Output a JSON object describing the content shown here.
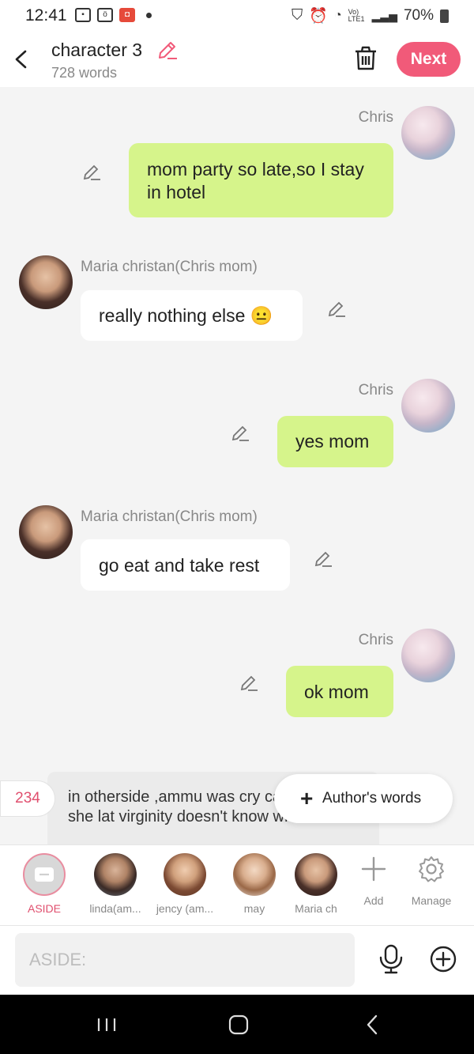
{
  "status_bar": {
    "time": "12:41",
    "battery": "70%",
    "signal_text": "Vo) LTE1"
  },
  "header": {
    "title": "character 3",
    "word_count": "728 words",
    "next_label": "Next"
  },
  "messages": [
    {
      "side": "right",
      "name": "Chris",
      "text": "mom party so late,so I stay in hotel"
    },
    {
      "side": "left",
      "name": "Maria christan(Chris mom)",
      "text": "really nothing else",
      "emoji": "😐"
    },
    {
      "side": "right",
      "name": "Chris",
      "text": "yes mom"
    },
    {
      "side": "left",
      "name": "Maria christan(Chris mom)",
      "text": "go eat and take rest"
    },
    {
      "side": "right",
      "name": "Chris",
      "text": "ok mom"
    }
  ],
  "aside_preview": {
    "count": "234",
    "text": "in otherside ,ammu was cry cab because she lat virginity doesn't know who he is"
  },
  "authors_words_label": "Author's words",
  "characters": [
    {
      "label": "ASIDE"
    },
    {
      "label": "linda(am..."
    },
    {
      "label": "jency (am..."
    },
    {
      "label": "may"
    },
    {
      "label": "Maria ch"
    }
  ],
  "tools": {
    "add_label": "Add",
    "manage_label": "Manage"
  },
  "input": {
    "placeholder": "ASIDE:"
  },
  "colors": {
    "accent": "#f15a79",
    "right_bubble": "#d6f48b",
    "left_bubble": "#ffffff",
    "background": "#f4f4f4"
  }
}
